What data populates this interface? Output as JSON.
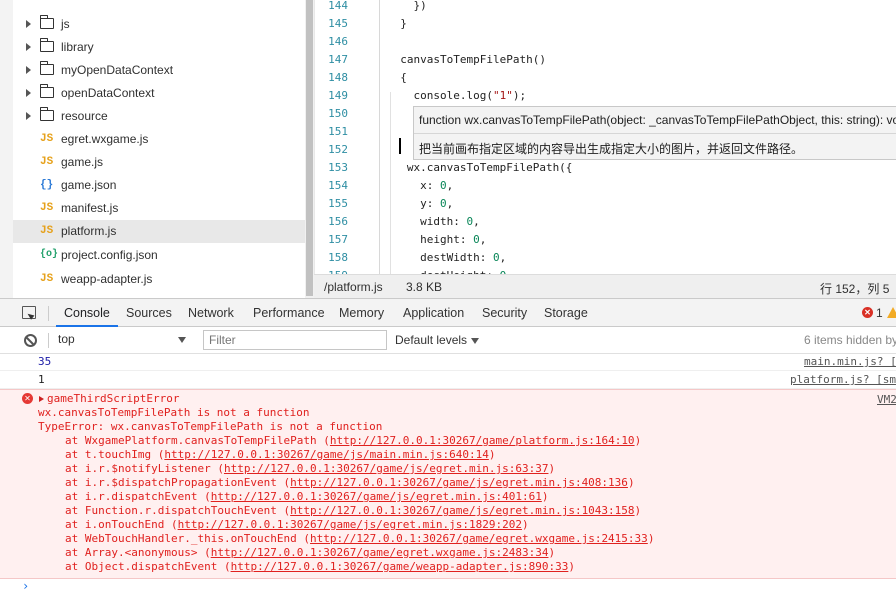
{
  "file_tree": {
    "items": [
      {
        "type": "folder",
        "label": "js",
        "icon": "folder-icon"
      },
      {
        "type": "folder",
        "label": "library",
        "icon": "folder-icon"
      },
      {
        "type": "folder",
        "label": "myOpenDataContext",
        "icon": "folder-icon"
      },
      {
        "type": "folder",
        "label": "openDataContext",
        "icon": "folder-icon"
      },
      {
        "type": "folder",
        "label": "resource",
        "icon": "folder-icon"
      },
      {
        "type": "file",
        "label": "egret.wxgame.js",
        "icon": "js-file-icon",
        "glyph": "JS"
      },
      {
        "type": "file",
        "label": "game.js",
        "icon": "js-file-icon",
        "glyph": "JS"
      },
      {
        "type": "file",
        "label": "game.json",
        "icon": "json-file-icon",
        "glyph": "{}"
      },
      {
        "type": "file",
        "label": "manifest.js",
        "icon": "js-file-icon",
        "glyph": "JS"
      },
      {
        "type": "file",
        "label": "platform.js",
        "icon": "js-file-icon",
        "glyph": "JS",
        "selected": true
      },
      {
        "type": "file",
        "label": "project.config.json",
        "icon": "config-file-icon",
        "glyph": "{o}"
      },
      {
        "type": "file",
        "label": "weapp-adapter.js",
        "icon": "js-file-icon",
        "glyph": "JS"
      }
    ]
  },
  "editor": {
    "lines": [
      {
        "n": "144",
        "code": "    })"
      },
      {
        "n": "145",
        "code": "  }"
      },
      {
        "n": "146",
        "code": ""
      },
      {
        "n": "147",
        "code": "  canvasToTempFilePath()"
      },
      {
        "n": "148",
        "code": "  {"
      },
      {
        "n": "149",
        "code": "    console.log(\"1\");"
      },
      {
        "n": "150",
        "code": ""
      },
      {
        "n": "151",
        "code": ""
      },
      {
        "n": "152",
        "code": ""
      },
      {
        "n": "153",
        "code": "   wx.canvasToTempFilePath({"
      },
      {
        "n": "154",
        "code": "     x: 0,"
      },
      {
        "n": "155",
        "code": "     y: 0,"
      },
      {
        "n": "156",
        "code": "     width: 0,"
      },
      {
        "n": "157",
        "code": "     height: 0,"
      },
      {
        "n": "158",
        "code": "     destWidth: 0,"
      },
      {
        "n": "159",
        "code": "     destHeight: 0"
      }
    ],
    "tooltip": {
      "signature": "function wx.canvasToTempFilePath(object: _canvasToTempFilePathObject, this: string): void",
      "description": "把当前画布指定区域的内容导出生成指定大小的图片，并返回文件路径。"
    }
  },
  "status_bar": {
    "file": "/platform.js",
    "size": "3.8 KB",
    "position": "行 152，列 5"
  },
  "devtools": {
    "tabs": [
      "Console",
      "Sources",
      "Network",
      "Performance",
      "Memory",
      "Application",
      "Security",
      "Storage"
    ],
    "active_tab": "Console",
    "error_count": "1",
    "toolbar": {
      "context": "top",
      "filter_placeholder": "Filter",
      "levels": "Default levels",
      "hidden": "6 items hidden by"
    },
    "logs": [
      {
        "value": "35",
        "source": "main.min.js? ["
      },
      {
        "value": "1",
        "source": "platform.js? [sm"
      }
    ],
    "error": {
      "name": "gameThirdScriptError",
      "source": "VM2",
      "message": "wx.canvasToTempFilePath is not a function",
      "type_error": "TypeError: wx.canvasToTempFilePath is not a function",
      "stack": [
        {
          "fn": "at WxgamePlatform.canvasToTempFilePath",
          "url": "http://127.0.0.1:30267/game/platform.js:164:10"
        },
        {
          "fn": "at t.touchImg",
          "url": "http://127.0.0.1:30267/game/js/main.min.js:640:14"
        },
        {
          "fn": "at i.r.$notifyListener",
          "url": "http://127.0.0.1:30267/game/js/egret.min.js:63:37"
        },
        {
          "fn": "at i.r.$dispatchPropagationEvent",
          "url": "http://127.0.0.1:30267/game/js/egret.min.js:408:136"
        },
        {
          "fn": "at i.r.dispatchEvent",
          "url": "http://127.0.0.1:30267/game/js/egret.min.js:401:61"
        },
        {
          "fn": "at Function.r.dispatchTouchEvent",
          "url": "http://127.0.0.1:30267/game/js/egret.min.js:1043:158"
        },
        {
          "fn": "at i.onTouchEnd",
          "url": "http://127.0.0.1:30267/game/js/egret.min.js:1829:202"
        },
        {
          "fn": "at WebTouchHandler._this.onTouchEnd",
          "url": "http://127.0.0.1:30267/game/egret.wxgame.js:2415:33"
        },
        {
          "fn": "at Array.<anonymous>",
          "url": "http://127.0.0.1:30267/game/egret.wxgame.js:2483:34"
        },
        {
          "fn": "at Object.dispatchEvent",
          "url": "http://127.0.0.1:30267/game/weapp-adapter.js:890:33"
        }
      ]
    },
    "prompt": "›"
  }
}
